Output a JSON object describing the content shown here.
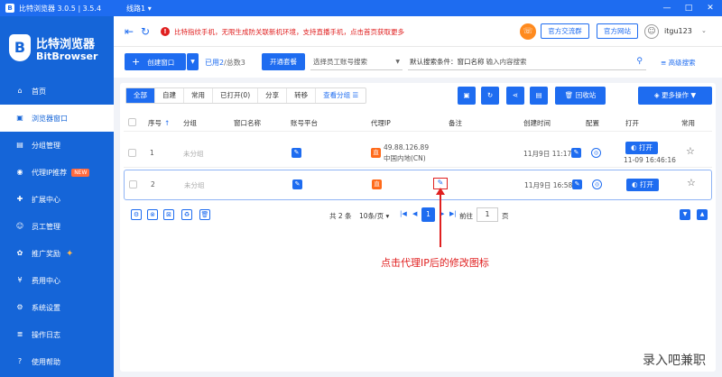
{
  "titlebar": {
    "app_title": "比特浏览器 3.0.5 | 3.5.4",
    "route": "线路1",
    "route_arrow": "▾",
    "logo_letter": "B"
  },
  "brand": {
    "name_cn": "比特浏览器",
    "name_en": "BitBrowser",
    "logo_letter": "B"
  },
  "nav": {
    "items": [
      {
        "label": "首页",
        "icon": "home-icon",
        "glyph": "⌂"
      },
      {
        "label": "浏览器窗口",
        "icon": "window-icon",
        "glyph": "▣"
      },
      {
        "label": "分组管理",
        "icon": "folder-icon",
        "glyph": "▤"
      },
      {
        "label": "代理IP推荐",
        "icon": "location-icon",
        "glyph": "◉"
      },
      {
        "label": "扩展中心",
        "icon": "puzzle-icon",
        "glyph": "✚"
      },
      {
        "label": "员工管理",
        "icon": "users-icon",
        "glyph": "☺"
      },
      {
        "label": "推广奖励",
        "icon": "gift-icon",
        "glyph": "✿"
      },
      {
        "label": "费用中心",
        "icon": "money-icon",
        "glyph": "¥"
      },
      {
        "label": "系统设置",
        "icon": "gear-icon",
        "glyph": "⚙"
      },
      {
        "label": "操作日志",
        "icon": "log-icon",
        "glyph": "≣"
      },
      {
        "label": "使用帮助",
        "icon": "help-icon",
        "glyph": "?"
      }
    ],
    "new_badge": "NEW"
  },
  "header": {
    "notice": "比特指纹手机，无限生成防关联新机环境，支持直播手机，点击首页获取更多",
    "group_btn": "官方交流群",
    "site_btn": "官方网站",
    "username": "itgu123",
    "chevron": "⌄"
  },
  "toolbar": {
    "create_label": "创建窗口",
    "create_plus": "+",
    "count_used": "已用2",
    "count_total": "/总数3",
    "suite_label": "开通套餐",
    "staff_placeholder": "选择员工账号搜索",
    "search_condition": "默认搜索条件：窗口名称",
    "search_placeholder": "输入内容搜索",
    "advanced_label": "高级搜索"
  },
  "tabs": [
    "全部",
    "自建",
    "常用",
    "已打开(0)",
    "分享",
    "转移",
    "查看分组"
  ],
  "actions": {
    "recycle_label": "回收站",
    "more_label": "更多操作"
  },
  "table": {
    "headers": {
      "seq": "序号",
      "sort_arrow": "↑",
      "group": "分组",
      "window_name": "窗口名称",
      "platform": "账号平台",
      "proxy": "代理IP",
      "remark": "备注",
      "created": "创建时间",
      "config": "配置",
      "open": "打开",
      "common": "常用"
    },
    "rows": [
      {
        "seq": "1",
        "group": "未分组",
        "proxy_chip": "直",
        "proxy_ip": "49.88.126.89",
        "proxy_region": "中国内地(CN)",
        "created": "11月9日 11:17",
        "open_label": "打开",
        "open_time": "11-09 16:46:16"
      },
      {
        "seq": "2",
        "group": "未分组",
        "proxy_chip": "直",
        "proxy_ip": "",
        "proxy_region": "",
        "created": "11月9日 16:58",
        "open_label": "打开",
        "open_time": ""
      }
    ]
  },
  "pagination": {
    "total": "共 2 条",
    "page_size": "10条/页",
    "current": "1",
    "goto_label": "前往",
    "goto_value": "1",
    "page_unit": "页"
  },
  "annotation": "点击代理IP后的修改图标",
  "watermark": "录入吧兼职",
  "colors": {
    "primary": "#1e6cf0",
    "sidebar": "#1565d8",
    "alert": "#e02020",
    "proxy_chip": "#ff6a1a"
  }
}
